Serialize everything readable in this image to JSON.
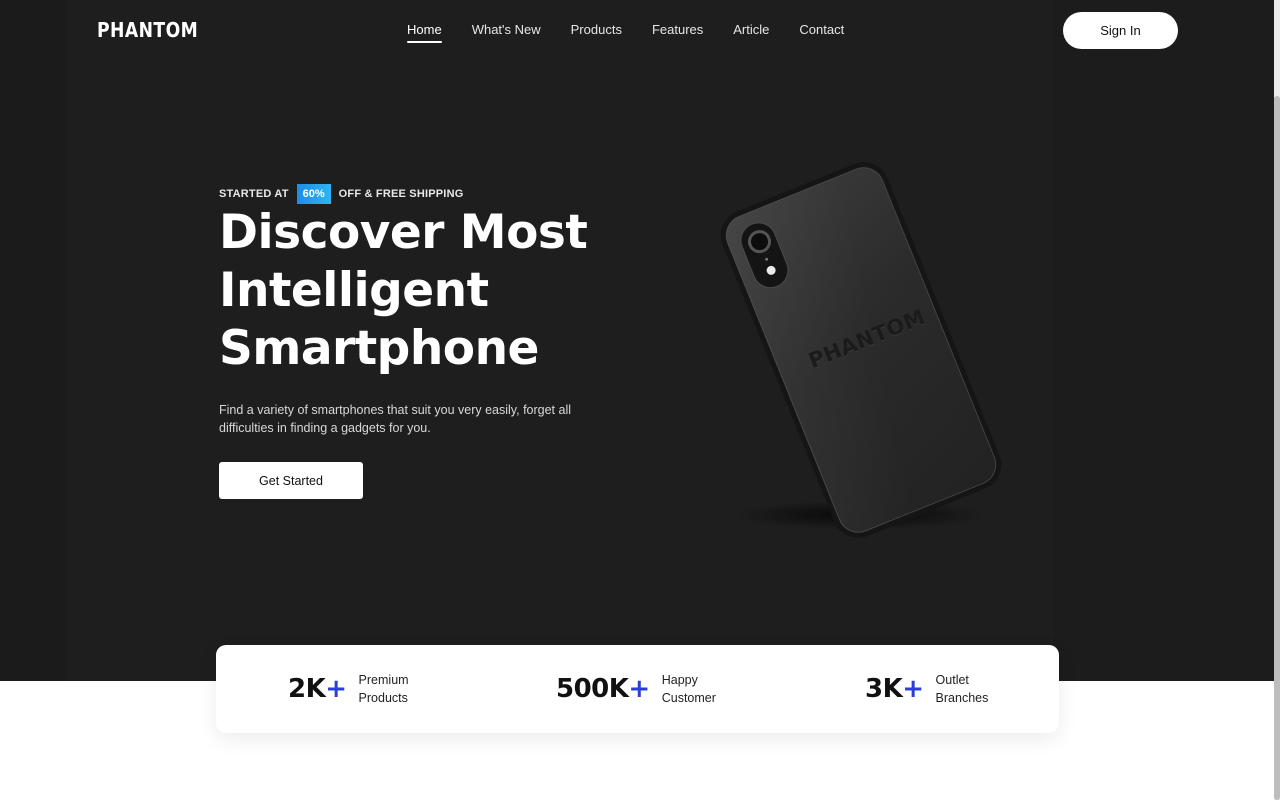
{
  "brand": {
    "logo": "PHANTOM"
  },
  "nav": {
    "items": [
      {
        "label": "Home",
        "active": true
      },
      {
        "label": "What's New",
        "active": false
      },
      {
        "label": "Products",
        "active": false
      },
      {
        "label": "Features",
        "active": false
      },
      {
        "label": "Article",
        "active": false
      },
      {
        "label": "Contact",
        "active": false
      }
    ],
    "signin_label": "Sign In"
  },
  "hero": {
    "tag_prefix": "STARTED AT",
    "tag_badge": "60%",
    "tag_suffix": "OFF & FREE SHIPPING",
    "headline_lines": [
      "Discover Most",
      "Intelligent",
      "Smartphone"
    ],
    "description": "Find a variety of smartphones that suit you very easily, forget all difficulties in finding a gadgets for you.",
    "cta_label": "Get Started",
    "phone_brand": "PHANTOM"
  },
  "stats": [
    {
      "number": "2K",
      "plus": "+",
      "label_line1": "Premium",
      "label_line2": "Products"
    },
    {
      "number": "500K",
      "plus": "+",
      "label_line1": "Happy",
      "label_line2": "Customer"
    },
    {
      "number": "3K",
      "plus": "+",
      "label_line1": "Outlet",
      "label_line2": "Branches"
    }
  ],
  "colors": {
    "hero_bg": "#1e1e1f",
    "accent_blue": "#2b3fd6",
    "badge_gradient_start": "#1c8de8",
    "badge_gradient_end": "#2fb4f2"
  }
}
